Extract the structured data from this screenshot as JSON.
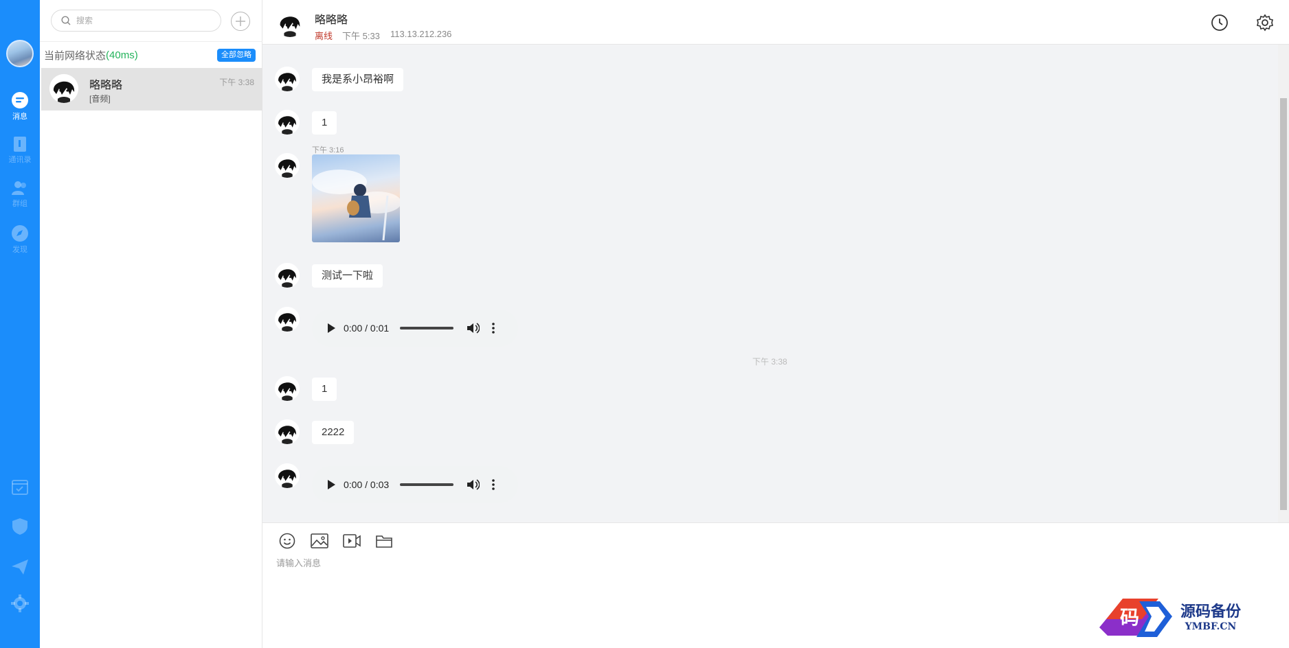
{
  "rail": {
    "items": [
      {
        "label": "消息",
        "active": true
      },
      {
        "label": "通讯录",
        "active": false
      },
      {
        "label": "群组",
        "active": false
      },
      {
        "label": "发现",
        "active": false
      }
    ],
    "accent": "#1b8dfb"
  },
  "search": {
    "placeholder": "搜索"
  },
  "network": {
    "label": "当前网络状态",
    "latency": "(40ms)",
    "ignore_all": "全部忽略"
  },
  "conversations": [
    {
      "name": "略略略",
      "last_message": "[音频]",
      "time": "下午 3:38"
    }
  ],
  "chat": {
    "name": "略略略",
    "status": "离线",
    "last_seen": "下午 5:33",
    "ip": "113.13.212.236"
  },
  "messages": [
    {
      "type": "text",
      "text": "我是系小昂裕啊"
    },
    {
      "type": "text",
      "text": "1"
    },
    {
      "type": "image",
      "time": "下午 3:16"
    },
    {
      "type": "text",
      "text": "测试一下啦"
    },
    {
      "type": "audio",
      "time_display": "0:00 / 0:01"
    },
    {
      "type": "divider",
      "text": "下午 3:38"
    },
    {
      "type": "text",
      "text": "1"
    },
    {
      "type": "text",
      "text": "2222"
    },
    {
      "type": "audio",
      "time_display": "0:00 / 0:03"
    }
  ],
  "composer": {
    "placeholder": "请输入消息"
  },
  "watermark": {
    "cn": "源码备份",
    "en": "YMBF.CN",
    "logo_char": "码"
  }
}
